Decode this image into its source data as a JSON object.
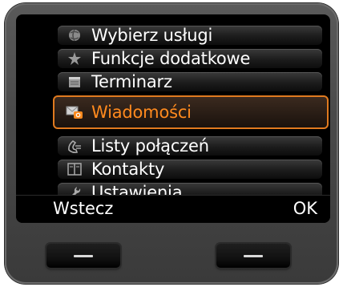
{
  "menu": {
    "items": [
      {
        "label": "Wybierz usługi",
        "icon": "globe-icon"
      },
      {
        "label": "Funkcje dodatkowe",
        "icon": "star-icon"
      },
      {
        "label": "Terminarz",
        "icon": "calendar-icon"
      },
      {
        "label": "Wiadomości",
        "icon": "messages-icon",
        "selected": true
      },
      {
        "label": "Listy połączeń",
        "icon": "call-list-icon"
      },
      {
        "label": "Kontakty",
        "icon": "book-icon"
      },
      {
        "label": "Ustawienia",
        "icon": "wrench-icon"
      }
    ]
  },
  "softkeys": {
    "left": "Wstecz",
    "right": "OK"
  },
  "colors": {
    "accent": "#e07a1f",
    "selected_text": "#ff8a1e"
  }
}
